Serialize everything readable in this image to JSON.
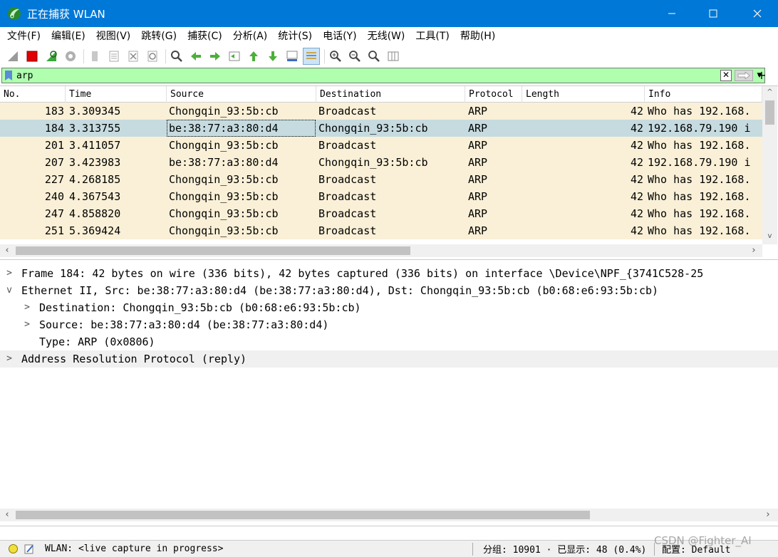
{
  "window": {
    "title": "正在捕获 WLAN"
  },
  "menu": [
    "文件(F)",
    "编辑(E)",
    "视图(V)",
    "跳转(G)",
    "捕获(C)",
    "分析(A)",
    "统计(S)",
    "电话(Y)",
    "无线(W)",
    "工具(T)",
    "帮助(H)"
  ],
  "toolbar_icons": [
    "shark-fin-start-icon",
    "stop-capture-icon",
    "restart-capture-icon",
    "capture-options-icon",
    "open-file-icon",
    "save-file-icon",
    "close-file-icon",
    "reload-file-icon",
    "find-packet-icon",
    "go-back-icon",
    "go-forward-icon",
    "go-to-packet-icon",
    "first-packet-icon",
    "last-packet-icon",
    "auto-scroll-icon",
    "colorize-icon",
    "zoom-in-icon",
    "zoom-out-icon",
    "normal-size-icon",
    "resize-columns-icon"
  ],
  "filter": {
    "value": "arp",
    "background": "#afffaf"
  },
  "columns": [
    "No.",
    "Time",
    "Source",
    "Destination",
    "Protocol",
    "Length",
    "Info"
  ],
  "packets": [
    {
      "no": "183",
      "time": "3.309345",
      "source": "Chongqin_93:5b:cb",
      "destination": "Broadcast",
      "protocol": "ARP",
      "length": "42",
      "info": "Who has 192.168.",
      "selected": false
    },
    {
      "no": "184",
      "time": "3.313755",
      "source": "be:38:77:a3:80:d4",
      "destination": "Chongqin_93:5b:cb",
      "protocol": "ARP",
      "length": "42",
      "info": "192.168.79.190 i",
      "selected": true
    },
    {
      "no": "201",
      "time": "3.411057",
      "source": "Chongqin_93:5b:cb",
      "destination": "Broadcast",
      "protocol": "ARP",
      "length": "42",
      "info": "Who has 192.168.",
      "selected": false
    },
    {
      "no": "207",
      "time": "3.423983",
      "source": "be:38:77:a3:80:d4",
      "destination": "Chongqin_93:5b:cb",
      "protocol": "ARP",
      "length": "42",
      "info": "192.168.79.190 i",
      "selected": false
    },
    {
      "no": "227",
      "time": "4.268185",
      "source": "Chongqin_93:5b:cb",
      "destination": "Broadcast",
      "protocol": "ARP",
      "length": "42",
      "info": "Who has 192.168.",
      "selected": false
    },
    {
      "no": "240",
      "time": "4.367543",
      "source": "Chongqin_93:5b:cb",
      "destination": "Broadcast",
      "protocol": "ARP",
      "length": "42",
      "info": "Who has 192.168.",
      "selected": false
    },
    {
      "no": "247",
      "time": "4.858820",
      "source": "Chongqin_93:5b:cb",
      "destination": "Broadcast",
      "protocol": "ARP",
      "length": "42",
      "info": "Who has 192.168.",
      "selected": false
    },
    {
      "no": "251",
      "time": "5.369424",
      "source": "Chongqin_93:5b:cb",
      "destination": "Broadcast",
      "protocol": "ARP",
      "length": "42",
      "info": "Who has 192.168.",
      "selected": false
    }
  ],
  "details": [
    {
      "text": "Frame 184: 42 bytes on wire (336 bits), 42 bytes captured (336 bits) on interface \\Device\\NPF_{3741C528-25",
      "expanded": false,
      "indent": 0
    },
    {
      "text": "Ethernet II, Src: be:38:77:a3:80:d4 (be:38:77:a3:80:d4), Dst: Chongqin_93:5b:cb (b0:68:e6:93:5b:cb)",
      "expanded": true,
      "indent": 0
    },
    {
      "text": "Destination: Chongqin_93:5b:cb (b0:68:e6:93:5b:cb)",
      "expanded": false,
      "indent": 1
    },
    {
      "text": "Source: be:38:77:a3:80:d4 (be:38:77:a3:80:d4)",
      "expanded": false,
      "indent": 1
    },
    {
      "text": "Type: ARP (0x0806)",
      "expanded": null,
      "indent": 1
    },
    {
      "text": "Address Resolution Protocol (reply)",
      "expanded": false,
      "indent": 0
    }
  ],
  "status": {
    "interface": "WLAN: <live capture in progress>",
    "packets": "分组: 10901 · 已显示: 48 (0.4%)",
    "profile": "配置: Default"
  },
  "watermark": "CSDN @Fighter_AI"
}
